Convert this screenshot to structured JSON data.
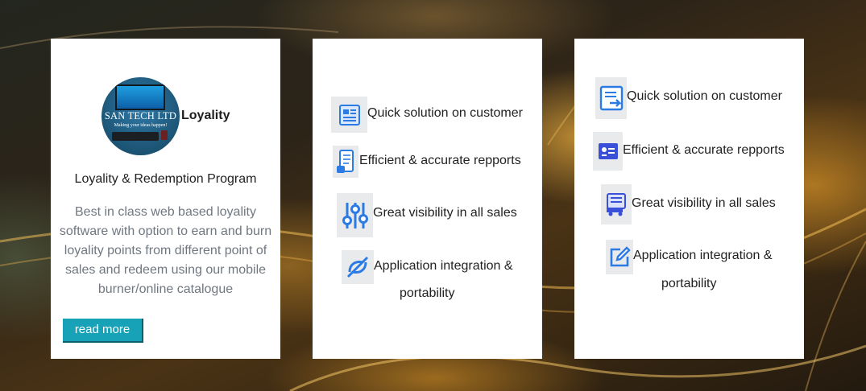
{
  "card_loyalty": {
    "logo": {
      "brand": "SAN TECH LTD",
      "tagline": "Making your ideas happen!",
      "icon": "san-tech-logo"
    },
    "title": "Loyality",
    "subtitle": "Loyality & Redemption Program",
    "description": "Best in class web based loyality software with option to earn and burn loyality points from different point of sales and redeem using our mobile burner/online catalogue",
    "button_label": "read more",
    "button_color": "#17a2b8"
  },
  "features_middle": [
    {
      "label": "Quick solution on customer",
      "icon": "document-list-icon"
    },
    {
      "label": "Efficient & accurate repports",
      "icon": "report-scroll-icon"
    },
    {
      "label": "Great visibility in all sales",
      "icon": "sliders-icon"
    },
    {
      "label_line1": "Application integration &",
      "label_line2": "portability",
      "icon": "integration-icon"
    }
  ],
  "features_right": [
    {
      "label": "Quick solution on customer",
      "icon": "document-arrow-icon"
    },
    {
      "label": "Efficient & accurate repports",
      "icon": "id-card-icon"
    },
    {
      "label": "Great visibility in all sales",
      "icon": "delivery-truck-icon"
    },
    {
      "label_line1": "Application integration &",
      "label_line2": "portability",
      "icon": "edit-icon"
    }
  ],
  "colors": {
    "icon_blue": "#2c7be5",
    "icon_bg": "#e9eaec"
  }
}
